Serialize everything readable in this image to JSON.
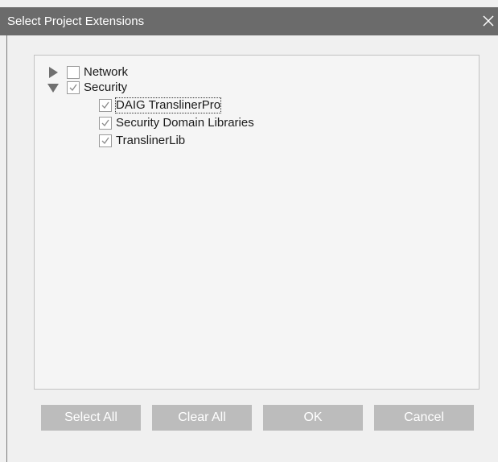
{
  "window": {
    "title": "Select Project Extensions",
    "close_icon": "close-icon"
  },
  "tree": {
    "items": [
      {
        "label": "Network",
        "expanded": false,
        "checked": false
      },
      {
        "label": "Security",
        "expanded": true,
        "checked": true,
        "children": [
          {
            "label": "DAIG TranslinerPro",
            "checked": true
          },
          {
            "label": "Security Domain Libraries",
            "checked": true
          },
          {
            "label": "TranslinerLib",
            "checked": true
          }
        ]
      }
    ]
  },
  "buttons": {
    "select_all": "Select All",
    "clear_all": "Clear All",
    "ok": "OK",
    "cancel": "Cancel"
  },
  "colors": {
    "titlebar": "#6b6b6b",
    "button_disabled": "#bcbcbc",
    "panel_background": "#f5f5f5"
  }
}
